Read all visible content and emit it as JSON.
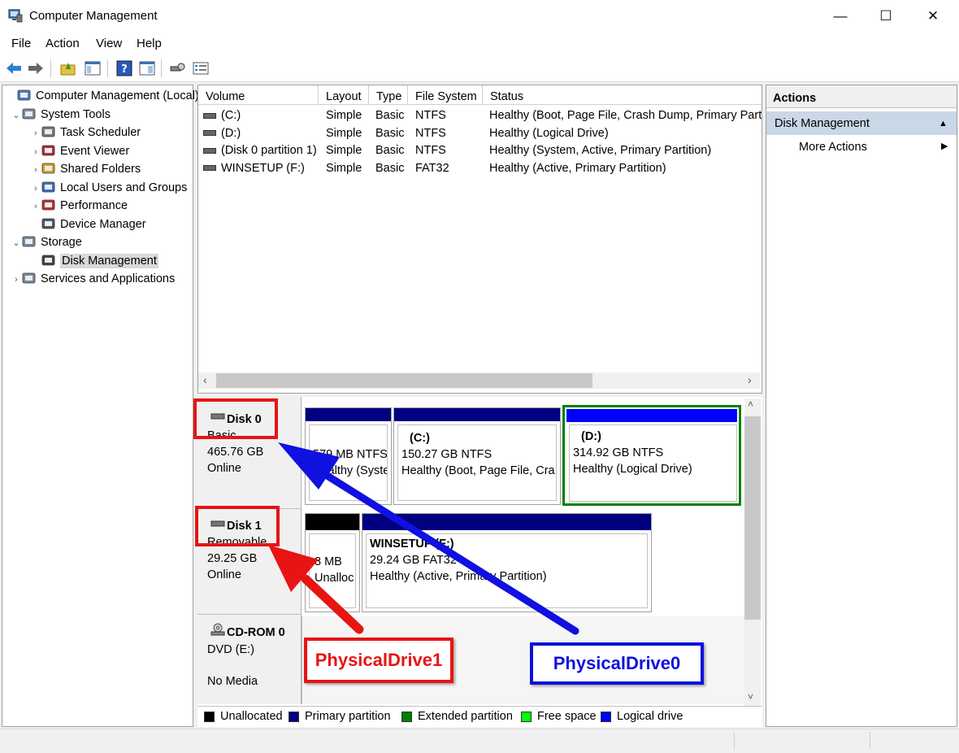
{
  "window": {
    "title": "Computer Management",
    "buttons": {
      "minimize": "—",
      "maximize": "☐",
      "close": "✕"
    }
  },
  "menu": [
    "File",
    "Action",
    "View",
    "Help"
  ],
  "tree": [
    {
      "label": "Computer Management (Local)",
      "icon": "computer-management-icon",
      "expander": ""
    },
    {
      "label": "System Tools",
      "icon": "tools-icon",
      "expander": "⌄"
    },
    {
      "label": "Task Scheduler",
      "icon": "clock-icon",
      "expander": "›"
    },
    {
      "label": "Event Viewer",
      "icon": "event-viewer-icon",
      "expander": "›"
    },
    {
      "label": "Shared Folders",
      "icon": "shared-folder-icon",
      "expander": "›"
    },
    {
      "label": "Local Users and Groups",
      "icon": "users-icon",
      "expander": "›"
    },
    {
      "label": "Performance",
      "icon": "performance-icon",
      "expander": "›"
    },
    {
      "label": "Device Manager",
      "icon": "device-manager-icon",
      "expander": ""
    },
    {
      "label": "Storage",
      "icon": "storage-icon",
      "expander": "⌄"
    },
    {
      "label": "Disk Management",
      "icon": "disk-management-icon",
      "expander": "",
      "selected": true
    },
    {
      "label": "Services and Applications",
      "icon": "services-icon",
      "expander": "›"
    }
  ],
  "volume_list": {
    "headers": [
      "Volume",
      "Layout",
      "Type",
      "File System",
      "Status"
    ],
    "rows": [
      {
        "volume": "(C:)",
        "layout": "Simple",
        "type": "Basic",
        "fs": "NTFS",
        "status": "Healthy (Boot, Page File, Crash Dump, Primary Part"
      },
      {
        "volume": "(D:)",
        "layout": "Simple",
        "type": "Basic",
        "fs": "NTFS",
        "status": "Healthy (Logical Drive)"
      },
      {
        "volume": "(Disk 0 partition 1)",
        "layout": "Simple",
        "type": "Basic",
        "fs": "NTFS",
        "status": "Healthy (System, Active, Primary Partition)"
      },
      {
        "volume": "WINSETUP (F:)",
        "layout": "Simple",
        "type": "Basic",
        "fs": "FAT32",
        "status": "Healthy (Active, Primary Partition)"
      }
    ]
  },
  "disks": [
    {
      "name": "Disk 0",
      "kind": "Basic",
      "size": "465.76 GB",
      "state": "Online",
      "partitions": [
        {
          "label": "",
          "line1": "579 MB NTFS",
          "line2": "Healthy (Syste"
        },
        {
          "label": "(C:)",
          "line1": "150.27 GB NTFS",
          "line2": "Healthy (Boot, Page File, Cra"
        },
        {
          "label": "(D:)",
          "line1": "314.92 GB NTFS",
          "line2": "Healthy (Logical Drive)"
        }
      ]
    },
    {
      "name": "Disk 1",
      "kind": "Removable",
      "size": "29.25 GB",
      "state": "Online",
      "partitions": [
        {
          "label": "",
          "line1": "8 MB",
          "line2": "Unalloc"
        },
        {
          "label": "WINSETUP (F:)",
          "line1": "29.24 GB FAT32",
          "line2": "Healthy (Active, Primary Partition)"
        }
      ]
    },
    {
      "name": "CD-ROM 0",
      "kind": "DVD (E:)",
      "size": "",
      "state": "No Media",
      "partitions": []
    }
  ],
  "legend": [
    {
      "label": "Unallocated",
      "color": "#000000"
    },
    {
      "label": "Primary partition",
      "color": "#000080"
    },
    {
      "label": "Extended partition",
      "color": "#008000"
    },
    {
      "label": "Free space",
      "color": "#00ff00"
    },
    {
      "label": "Logical drive",
      "color": "#0000ff"
    }
  ],
  "actions": {
    "header": "Actions",
    "section": "Disk Management",
    "more": "More Actions"
  },
  "annotations": {
    "physical_drive_1": "PhysicalDrive1",
    "physical_drive_0": "PhysicalDrive0",
    "colors": {
      "red": "#e81414",
      "blue": "#1010e0"
    }
  }
}
